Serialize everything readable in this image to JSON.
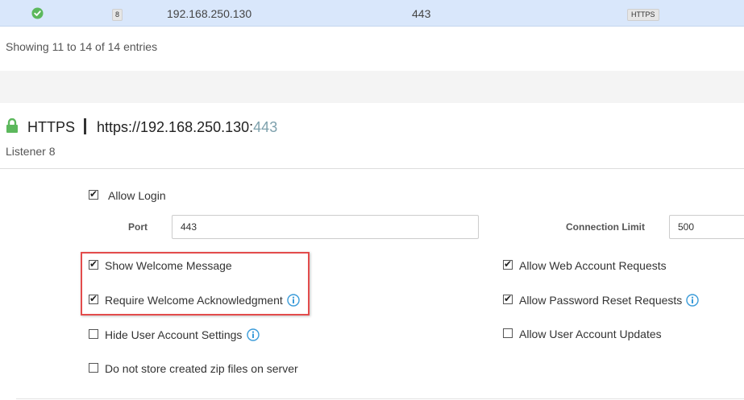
{
  "table_row": {
    "status_icon": "check-circle-icon",
    "listener_number": "8",
    "ip": "192.168.250.130",
    "port": "443",
    "protocol": "HTTPS"
  },
  "entries_text": "Showing 11 to 14 of 14 entries",
  "listener_header": {
    "lock_icon": "lock-icon",
    "protocol": "HTTPS",
    "url_base": "https://192.168.250.130:",
    "url_port": "443",
    "subtitle": "Listener 8"
  },
  "form": {
    "allow_login": {
      "label": "Allow Login",
      "checked": true
    },
    "port": {
      "label": "Port",
      "value": "443"
    },
    "connection_limit": {
      "label": "Connection Limit",
      "value": "500"
    },
    "show_welcome": {
      "label": "Show Welcome Message",
      "checked": true
    },
    "require_ack": {
      "label": "Require Welcome Acknowledgment",
      "checked": true
    },
    "hide_user_settings": {
      "label": "Hide User Account Settings",
      "checked": false
    },
    "no_store_zip": {
      "label": "Do not store created zip files on server",
      "checked": false
    },
    "allow_web_requests": {
      "label": "Allow Web Account Requests",
      "checked": true
    },
    "allow_password_reset": {
      "label": "Allow Password Reset Requests",
      "checked": true
    },
    "allow_user_updates": {
      "label": "Allow User Account Updates",
      "checked": false
    }
  },
  "colors": {
    "selected_row": "#d9e7fb",
    "ok_green": "#5cb85c",
    "lock_green": "#5cb85c",
    "info_blue": "#3a9bd9",
    "highlight_red": "#e34c4c",
    "url_port": "#7ea1ad"
  }
}
